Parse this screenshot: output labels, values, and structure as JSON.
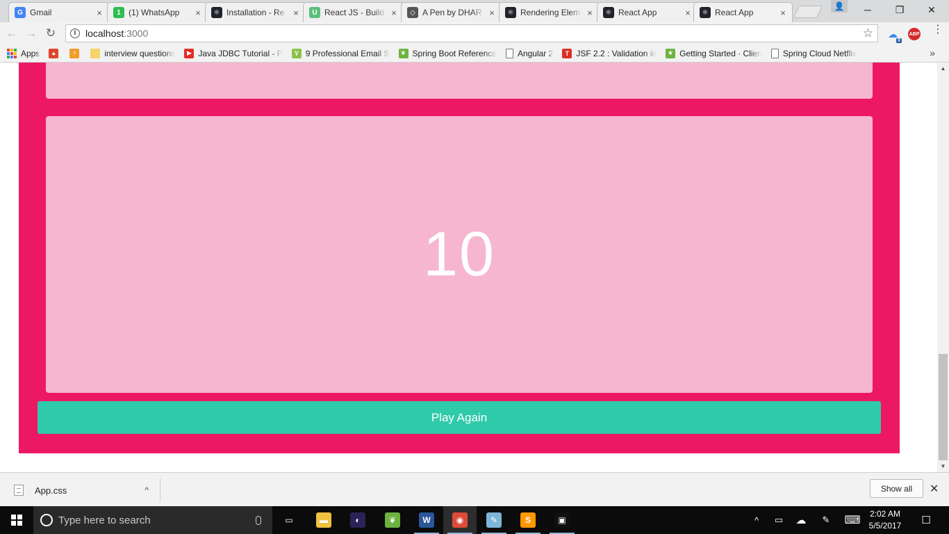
{
  "browser": {
    "tabs": [
      {
        "title": "Gmail",
        "icon": "gmail-icon",
        "color": "#4285f4",
        "glyph": "G"
      },
      {
        "title": "(1) WhatsApp",
        "icon": "whatsapp-icon",
        "color": "#2fbd4f",
        "glyph": "1"
      },
      {
        "title": "Installation - Re",
        "icon": "react-icon",
        "color": "#20232a",
        "glyph": "⚛"
      },
      {
        "title": "React JS - Build",
        "icon": "udemy-icon",
        "color": "#5cbf7d",
        "glyph": "U"
      },
      {
        "title": "A Pen by DHAR",
        "icon": "codepen-icon",
        "color": "#555555",
        "glyph": "◇"
      },
      {
        "title": "Rendering Elem",
        "icon": "react-icon",
        "color": "#20232a",
        "glyph": "⚛"
      },
      {
        "title": "React App",
        "icon": "react-icon",
        "color": "#20232a",
        "glyph": "⚛"
      },
      {
        "title": "React App",
        "icon": "react-icon",
        "color": "#20232a",
        "glyph": "⚛"
      }
    ],
    "active_tab_index": 7,
    "tab_close_glyph": "×",
    "window_controls": {
      "minimize": "─",
      "restore": "❐",
      "close": "✕"
    },
    "profile_glyph": "👤",
    "nav": {
      "back": "←",
      "forward": "→",
      "reload": "↻"
    },
    "address": {
      "host": "localhost",
      "port": ":3000"
    },
    "info_glyph": "i",
    "star_glyph": "☆",
    "ext_abp": "ABP",
    "ext_badge": "0",
    "menu_glyph": "⋮",
    "bookmarks_more": "»",
    "bookmarks": [
      {
        "label": "Apps",
        "icon": "apps-grid-icon"
      },
      {
        "label": "",
        "icon": "chrome-icon",
        "color": "#e0442f",
        "glyph": "●"
      },
      {
        "label": "",
        "icon": "bolt-icon",
        "color": "#f29d2a",
        "glyph": "⚡"
      },
      {
        "label": "interview questions",
        "icon": "folder-icon",
        "color": "#f6d36b",
        "glyph": ""
      },
      {
        "label": "Java JDBC Tutorial - P",
        "icon": "youtube-icon",
        "color": "#e52d27",
        "glyph": "▶"
      },
      {
        "label": "9 Professional Email S",
        "icon": "y-icon",
        "color": "#8bc34a",
        "glyph": "Y"
      },
      {
        "label": "Spring Boot Reference",
        "icon": "spring-icon",
        "color": "#6db33f",
        "glyph": "❦"
      },
      {
        "label": "Angular 2",
        "icon": "page-icon",
        "color": "#ffffff",
        "glyph": ""
      },
      {
        "label": "JSF 2.2 : Validation in",
        "icon": "tp-icon",
        "color": "#d93025",
        "glyph": "T"
      },
      {
        "label": "Getting Started · Clien",
        "icon": "spring-icon",
        "color": "#6db33f",
        "glyph": "❦"
      },
      {
        "label": "Spring Cloud Netflix",
        "icon": "page-icon",
        "color": "#ffffff",
        "glyph": ""
      }
    ]
  },
  "app": {
    "colors": {
      "background": "#ed1864",
      "tile": "#f7b6cf",
      "button": "#2ecaaa",
      "tile_text": "#ffffff"
    },
    "tile_value": "10",
    "play_again_label": "Play Again"
  },
  "downloads": {
    "file_name": "App.css",
    "caret": "^",
    "show_all_label": "Show all",
    "close_glyph": "✕"
  },
  "taskbar": {
    "search_placeholder": "Type here to search",
    "apps": [
      {
        "icon": "task-view-icon",
        "color": "transparent",
        "glyph": "▭"
      },
      {
        "icon": "file-explorer-icon",
        "color": "#f0c040",
        "glyph": "▬"
      },
      {
        "icon": "eclipse-icon",
        "color": "#2c2255",
        "glyph": "◐"
      },
      {
        "icon": "spring-tool-suite-icon",
        "color": "#6db33f",
        "glyph": "❦"
      },
      {
        "icon": "word-icon",
        "color": "#2b579a",
        "glyph": "W"
      },
      {
        "icon": "chrome-icon",
        "color": "#dd4b39",
        "glyph": "◉"
      },
      {
        "icon": "notepad-icon",
        "color": "#7fb5d9",
        "glyph": "✎"
      },
      {
        "icon": "sublime-icon",
        "color": "#ff9800",
        "glyph": "S"
      },
      {
        "icon": "cmd-icon",
        "color": "#111111",
        "glyph": "▣"
      }
    ],
    "active_app_index": 5,
    "tray": {
      "chevron": "^",
      "battery": "▭",
      "cloud": "☁",
      "pen": "✎",
      "keyboard": "⌨",
      "notification": "☐"
    },
    "time": "2:02 AM",
    "date": "5/5/2017"
  }
}
